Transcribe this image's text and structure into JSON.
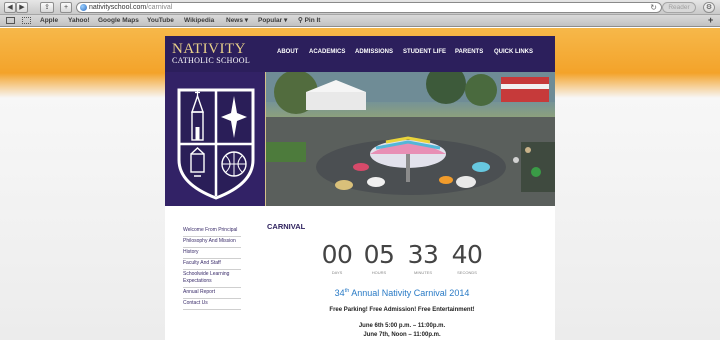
{
  "browser": {
    "url_domain": "nativityschool.com",
    "url_path": "/carnival",
    "reader_label": "Reader",
    "bookmarks": [
      "Apple",
      "Yahoo!",
      "Google Maps",
      "YouTube",
      "Wikipedia",
      "News",
      "Popular",
      "Pin It"
    ]
  },
  "site": {
    "logo_main": "NATIVITY",
    "logo_sub": "CATHOLIC SCHOOL",
    "nav": [
      "ABOUT",
      "ACADEMICS",
      "ADMISSIONS",
      "STUDENT LIFE",
      "PARENTS",
      "QUICK LINKS"
    ]
  },
  "sidebar": {
    "items": [
      "Welcome From Principal",
      "Philosophy And Mission",
      "History",
      "Faculty And Staff",
      "Schoolwide Learning Expectations",
      "Annual Report",
      "Contact Us"
    ]
  },
  "main": {
    "title": "CARNIVAL",
    "countdown": {
      "days": "00",
      "hours": "05",
      "minutes": "33",
      "seconds": "40",
      "days_label": "DAYS",
      "hours_label": "HOURS",
      "minutes_label": "MINUTES",
      "seconds_label": "SECONDS"
    },
    "headline_number": "34",
    "headline_suffix": "th",
    "headline_rest": " Annual Nativity Carnival 2014",
    "subline": "Free Parking! Free Admission! Free Entertainment!",
    "dates": [
      "June 6th 5:00 p.m. – 11:00p.m.",
      "June 7th, Noon – 11:00p.m."
    ]
  },
  "colors": {
    "brand_purple": "#2c1f5c",
    "gold": "#e8d08a",
    "headline_blue": "#2a7bc6",
    "orange_bg": "#f4a32a"
  }
}
